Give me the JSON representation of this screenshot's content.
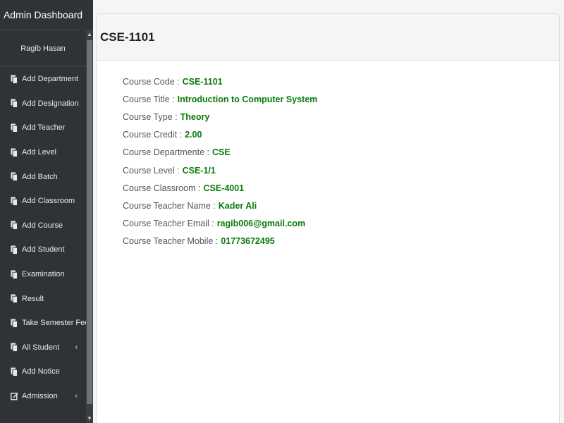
{
  "sidebar": {
    "title": "Admin Dashboard",
    "user": "Ragib Hasan",
    "items": [
      {
        "label": "Add Department",
        "icon": "copy-icon"
      },
      {
        "label": "Add Designation",
        "icon": "copy-icon"
      },
      {
        "label": "Add Teacher",
        "icon": "copy-icon"
      },
      {
        "label": "Add Level",
        "icon": "copy-icon"
      },
      {
        "label": "Add Batch",
        "icon": "copy-icon"
      },
      {
        "label": "Add Classroom",
        "icon": "copy-icon"
      },
      {
        "label": "Add Course",
        "icon": "copy-icon"
      },
      {
        "label": "Add Student",
        "icon": "copy-icon"
      },
      {
        "label": "Examination",
        "icon": "copy-icon"
      },
      {
        "label": "Result",
        "icon": "copy-icon"
      },
      {
        "label": "Take Semester Fees",
        "icon": "copy-icon"
      },
      {
        "label": "All Student",
        "icon": "copy-icon",
        "chevron": "‹"
      },
      {
        "label": "Add Notice",
        "icon": "copy-icon"
      },
      {
        "label": "Admission",
        "icon": "edit-icon",
        "chevron": "‹"
      }
    ]
  },
  "panel": {
    "title": "CSE-1101",
    "fields": [
      {
        "label": "Course Code :",
        "value": "CSE-1101"
      },
      {
        "label": "Course Title :",
        "value": "Introduction to Computer System"
      },
      {
        "label": "Course Type :",
        "value": "Theory"
      },
      {
        "label": "Course Credit :",
        "value": "2.00"
      },
      {
        "label": "Course Departmente :",
        "value": "CSE"
      },
      {
        "label": "Course Level :",
        "value": "CSE-1/1"
      },
      {
        "label": "Course Classroom :",
        "value": "CSE-4001"
      },
      {
        "label": "Course Teacher Name :",
        "value": "Kader Ali"
      },
      {
        "label": "Course Teacher Email :",
        "value": "ragib006@gmail.com"
      },
      {
        "label": "Course Teacher Mobile :",
        "value": "01773672495"
      }
    ]
  },
  "colors": {
    "sidebar_bg": "#2f3338",
    "value_green": "#0a7a0a"
  }
}
